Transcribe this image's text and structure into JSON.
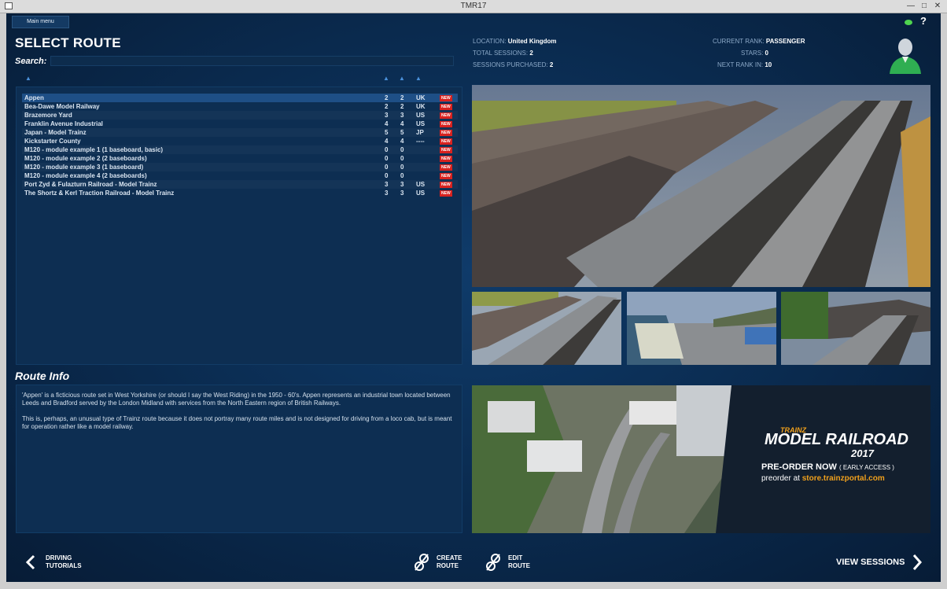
{
  "window": {
    "title": "TMR17",
    "minimize": "—",
    "maximize": "□",
    "close": "✕"
  },
  "topbar": {
    "main_menu": "Main menu",
    "help": "?"
  },
  "select": {
    "title": "SELECT ROUTE",
    "search_label": "Search:",
    "search_value": ""
  },
  "routes": [
    {
      "name": "Appen",
      "a": "2",
      "b": "2",
      "region": "UK",
      "badge": "NEW",
      "selected": true
    },
    {
      "name": "Bea-Dawe Model Railway",
      "a": "2",
      "b": "2",
      "region": "UK",
      "badge": "NEW"
    },
    {
      "name": "Brazemore Yard",
      "a": "3",
      "b": "3",
      "region": "US",
      "badge": "NEW"
    },
    {
      "name": "Franklin Avenue Industrial",
      "a": "4",
      "b": "4",
      "region": "US",
      "badge": "NEW"
    },
    {
      "name": "Japan - Model Trainz",
      "a": "5",
      "b": "5",
      "region": "JP",
      "badge": "NEW"
    },
    {
      "name": "Kickstarter County",
      "a": "4",
      "b": "4",
      "region": "----",
      "badge": "NEW"
    },
    {
      "name": "M120 - module example 1 (1 baseboard, basic)",
      "a": "0",
      "b": "0",
      "region": "",
      "badge": "NEW"
    },
    {
      "name": "M120 - module example 2 (2 baseboards)",
      "a": "0",
      "b": "0",
      "region": "",
      "badge": "NEW"
    },
    {
      "name": "M120 - module example 3 (1 baseboard)",
      "a": "0",
      "b": "0",
      "region": "",
      "badge": "NEW"
    },
    {
      "name": "M120 - module example 4 (2 baseboards)",
      "a": "0",
      "b": "0",
      "region": "",
      "badge": "NEW"
    },
    {
      "name": "Port Zyd & Fulazturn Railroad - Model Trainz",
      "a": "3",
      "b": "3",
      "region": "US",
      "badge": "NEW"
    },
    {
      "name": "The Shortz & Kerl Traction Railroad - Model Trainz",
      "a": "3",
      "b": "3",
      "region": "US",
      "badge": "NEW"
    }
  ],
  "route_info": {
    "title": "Route Info",
    "para1": "'Appen' is a ficticious route set in West Yorkshire (or should I say the West Riding) in the 1950 - 60's. Appen represents an industrial town located between Leeds and Bradford served by the London Midland with services from the North Eastern region of British Railways.",
    "para2": "This is, perhaps, an unusual type of Trainz route because it does not portray many route miles and is not designed for driving from a loco cab, but is meant for operation rather like a model railway."
  },
  "stats": {
    "location_label": "LOCATION:",
    "location": "United Kingdom",
    "sessions_label": "TOTAL SESSIONS:",
    "sessions": "2",
    "purchased_label": "SESSIONS PURCHASED:",
    "purchased": "2",
    "rank_label": "CURRENT RANK:",
    "rank": "PASSENGER",
    "stars_label": "STARS:",
    "stars": "0",
    "next_label": "NEXT RANK IN:",
    "next": "10"
  },
  "banner": {
    "brand": "TRAINZ",
    "line1": "MODEL RAILROAD",
    "year": "2017",
    "preorder": "PRE-ORDER NOW",
    "access": "( EARLY ACCESS )",
    "at": "preorder at",
    "store": "store.trainzportal.com"
  },
  "nav": {
    "driving_1": "DRIVING",
    "driving_2": "TUTORIALS",
    "create_1": "CREATE",
    "create_2": "ROUTE",
    "edit_1": "EDIT",
    "edit_2": "ROUTE",
    "view": "VIEW SESSIONS"
  },
  "colors": {
    "accent": "#4a90d9",
    "new_badge": "#d8221f",
    "banner_orange": "#f0a01c",
    "selected_row": "#1e4f86"
  }
}
